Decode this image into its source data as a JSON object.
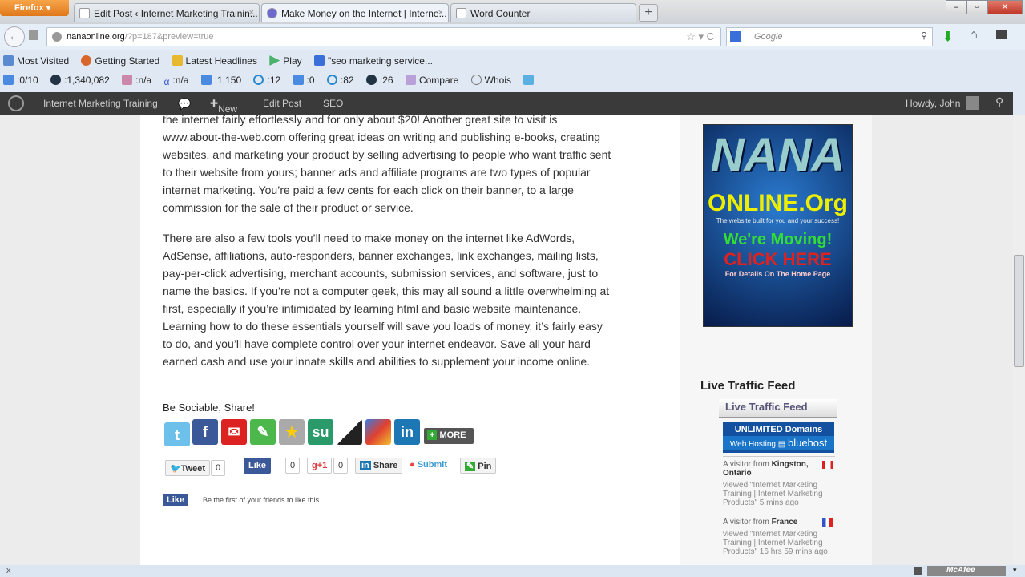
{
  "browser": {
    "menu": "Firefox",
    "tabs": [
      {
        "label": "Edit Post ‹ Internet Marketing Trainin..."
      },
      {
        "label": "Make Money on the Internet | Interne..."
      },
      {
        "label": "Word Counter"
      }
    ],
    "url_host": "nanaonline.org",
    "url_path": "/?p=187&preview=true",
    "search_placeholder": "Google"
  },
  "bookmarks": [
    "Most Visited",
    "Getting Started",
    "Latest Headlines",
    "Play",
    "\"seo marketing service..."
  ],
  "seo_toolbar": [
    ":0/10",
    ":1,340,082",
    ":n/a",
    ":n/a",
    ":1,150",
    ":12",
    ":0",
    ":82",
    ":26",
    "Compare",
    "Whois"
  ],
  "wp_admin": {
    "site": "Internet Marketing Training",
    "new": "New",
    "edit": "Edit Post",
    "seo": "SEO",
    "howdy": "Howdy, John"
  },
  "article": {
    "p1": "the internet fairly effortlessly and for only about $20! Another great site to visit is www.about-the-web.com offering great ideas on writing and publishing e-books, creating websites, and marketing your product by selling advertising to people who want traffic sent to their website from yours; banner ads and affiliate programs are two types of popular internet marketing. You’re paid a few cents for each click on their banner, to a large commission for the sale of their product or service.",
    "p2": "There are also a few tools you’ll need to make money on the internet like AdWords, AdSense, affiliations, auto-responders, banner exchanges, link exchanges, mailing lists, pay-per-click advertising, merchant accounts, submission services, and software, just to name the basics. If you’re not a computer geek, this may all sound a little overwhelming at first, especially if you’re intimidated by learning html and basic website maintenance. Learning how to do these essentials yourself will save you loads of money, it’s fairly easy to do, and you’ll have complete control over your internet endeavor. Save all your hard earned cash and use your innate skills and abilities to supplement your income online.",
    "share_heading": "Be Sociable, Share!",
    "more": "MORE",
    "buttons": {
      "tweet": "Tweet",
      "tweet_count": "0",
      "like": "Like",
      "like_count": "0",
      "plus": "+1",
      "plus_count": "0",
      "share": "Share",
      "submit": "Submit",
      "pin": "Pin"
    },
    "fb_like": "Like",
    "fb_text": "Be the first of your friends to like this."
  },
  "sidebar": {
    "ad": {
      "title": "NANA",
      "sub": "ONLINE.Org",
      "tag": "The website built for you and your success!",
      "moving": "We're Moving!",
      "click": "CLICK HERE",
      "details": "For Details On The Home Page"
    },
    "feed_title": "Live Traffic Feed",
    "widget_title": "Live Traffic Feed",
    "banner1": "UNLIMITED Domains",
    "banner2": "Web Hosting",
    "banner3": "bluehost",
    "visitors": [
      {
        "pre": "A visitor from ",
        "place": "Kingston, Ontario",
        "viewed": "viewed \"Internet Marketing Training | Internet Marketing Products\" 5 mins ago"
      },
      {
        "pre": "A visitor from ",
        "place": "France",
        "viewed": "viewed \"Internet Marketing Training | Internet Marketing Products\" 16 hrs 59 mins ago"
      }
    ]
  },
  "status": {
    "close": "x",
    "mcafee": "McAfee"
  }
}
